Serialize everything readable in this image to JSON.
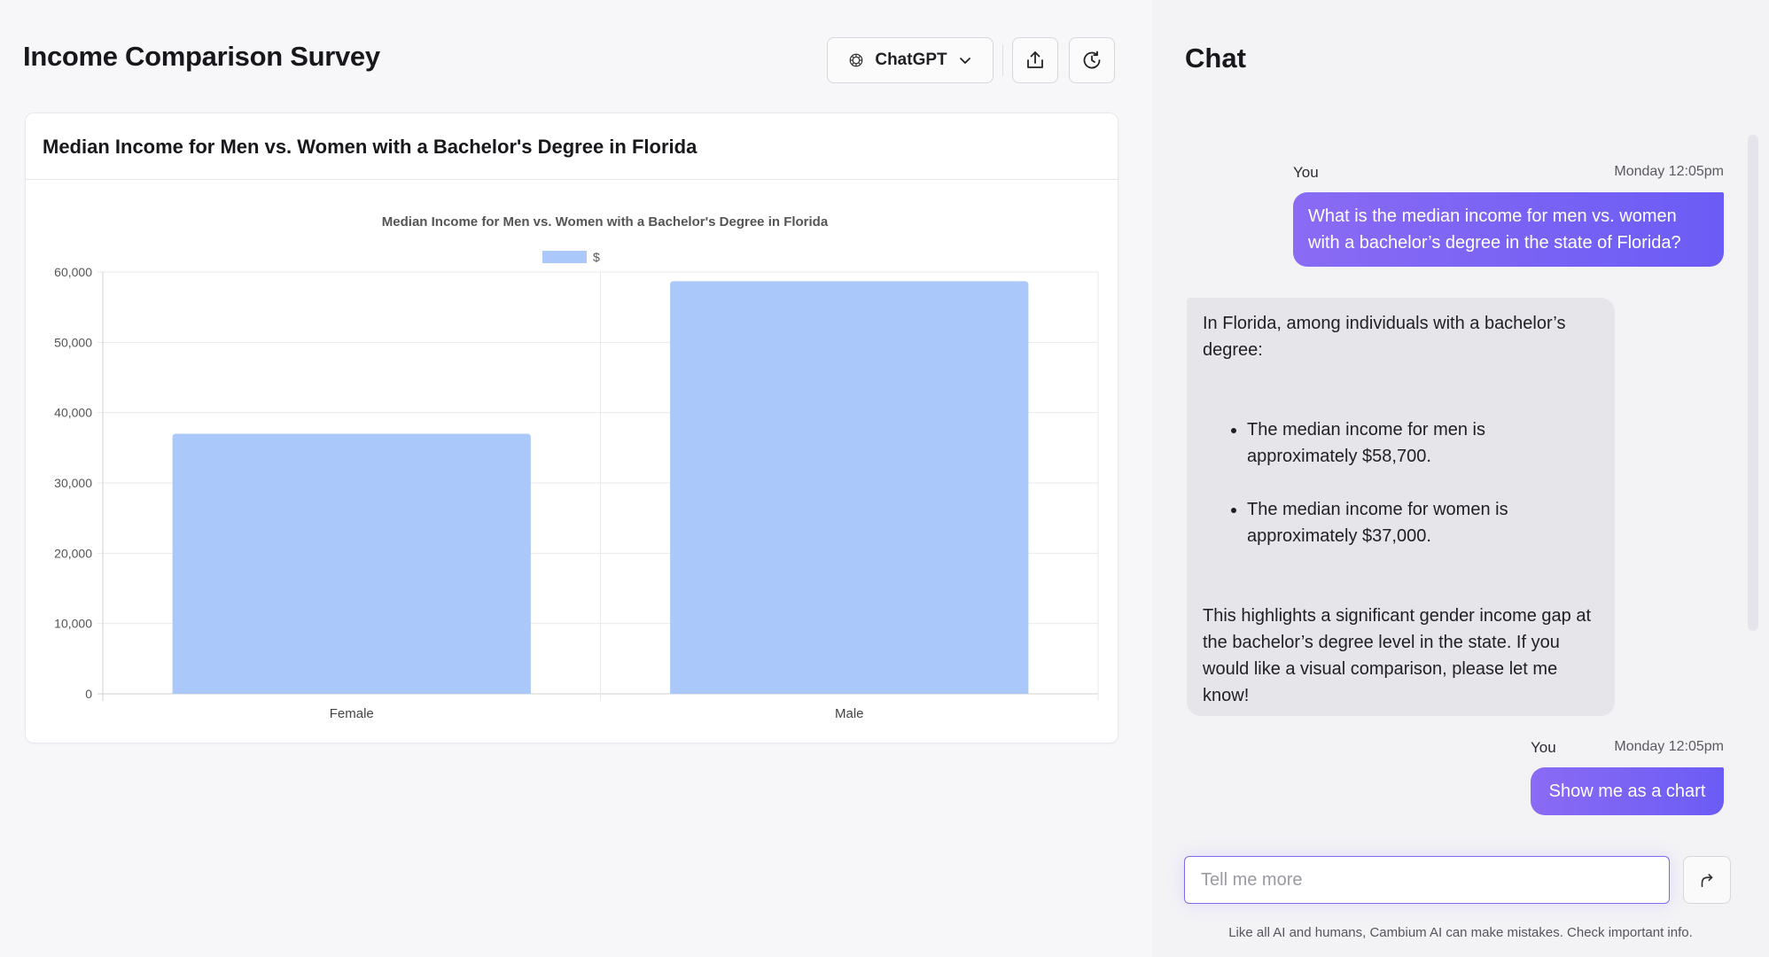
{
  "page": {
    "title": "Income Comparison Survey",
    "model_select": {
      "label": "ChatGPT",
      "icon": "openai-icon",
      "chevron": "chevron-down-icon"
    },
    "toolbar_icons": [
      "share-upload-icon",
      "history-icon"
    ]
  },
  "chart_card": {
    "title": "Median Income for Men vs. Women with a Bachelor's Degree in Florida"
  },
  "chart_data": {
    "type": "bar",
    "title": "Median Income for Men vs. Women with a Bachelor's Degree in Florida",
    "categories": [
      "Female",
      "Male"
    ],
    "series": [
      {
        "name": "$",
        "values": [
          37000,
          58700
        ],
        "color": "#abc8fb"
      }
    ],
    "ylim": [
      0,
      60000
    ],
    "yticks": [
      0,
      10000,
      20000,
      30000,
      40000,
      50000,
      60000
    ],
    "ytick_labels": [
      "0",
      "10,000",
      "20,000",
      "30,000",
      "40,000",
      "50,000",
      "60,000"
    ],
    "xlabel": "",
    "ylabel": "",
    "grid": true,
    "legend": "top-center"
  },
  "chat": {
    "title": "Chat",
    "messages": [
      {
        "role": "user",
        "author": "You",
        "time": "Monday 12:05pm",
        "text": "What is the median income for men vs. women with a bachelor’s degree in the state of Florida?"
      },
      {
        "role": "assistant",
        "intro": "In Florida, among individuals with a bachelor’s degree:",
        "bullets": [
          "The median income for men is approximately $58,700.",
          "The median income for women is approximately $37,000."
        ],
        "closing": "This highlights a significant gender income gap at the bachelor’s degree level in the state. If you would like a visual comparison, please let me know!"
      },
      {
        "role": "user",
        "author": "You",
        "time": "Monday 12:05pm",
        "text": "Show me as a chart"
      }
    ],
    "input": {
      "placeholder": "Tell me more",
      "value": ""
    },
    "send_icon": "send-arrow-icon",
    "disclaimer": "Like all AI and humans, Cambium AI can make mistakes. Check important info."
  },
  "colors": {
    "accent": "#7b63f4",
    "bar": "#abc8fb",
    "assistant_bubble": "#e6e6ea"
  }
}
